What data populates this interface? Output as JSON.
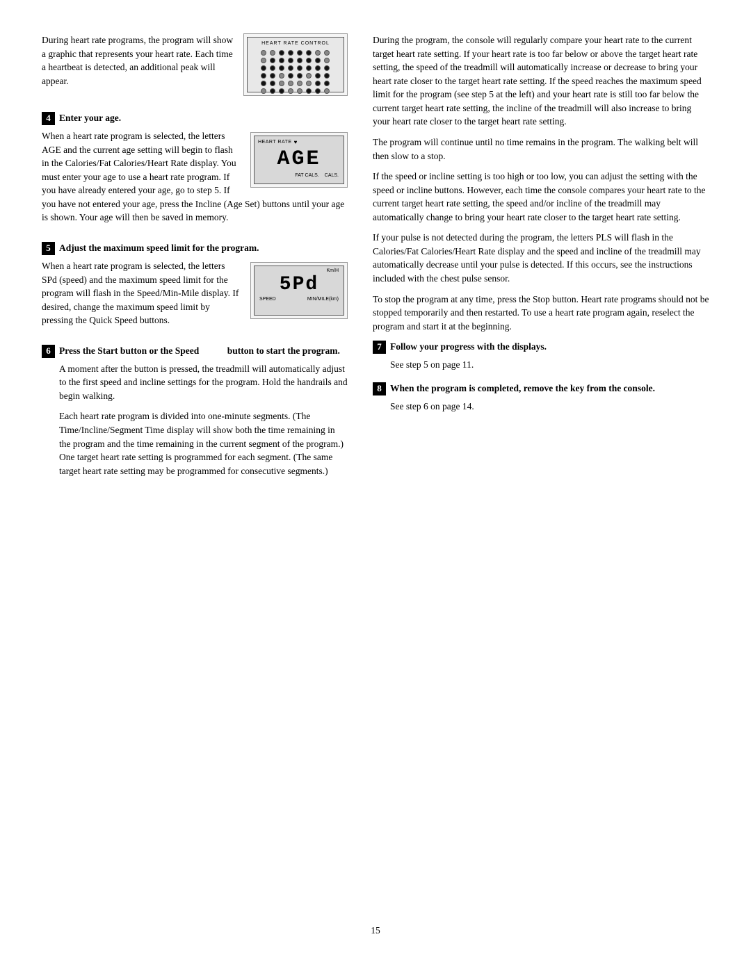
{
  "page": {
    "number": "15"
  },
  "left_col": {
    "intro_para": "During heart rate programs, the program will show a graphic that represents your heart rate. Each time a heartbeat is detected, an additional peak will appear.",
    "step4": {
      "number": "4",
      "title": "Enter your age.",
      "para1": "When a heart rate program is selected, the letters AGE and the current age setting will begin to flash in the Calories/Fat Calories/Heart Rate display. You must enter your age to use a heart rate program. If you have already entered your age, go to step 5. If you have not entered your age, press the Incline (Age Set) buttons until your age is shown. Your age will then be saved in memory."
    },
    "step5": {
      "number": "5",
      "title": "Adjust the maximum speed limit for the program.",
      "para1": "When a heart rate program is selected, the letters SPd (speed) and the maximum speed limit for the program will flash in the Speed/Min-Mile display. If desired, change the maximum speed limit by pressing the Quick Speed buttons."
    },
    "step6": {
      "number": "6",
      "title": "Press the Start button or the Speed",
      "title2": "button to start the program.",
      "para1": "A moment after the button is pressed, the treadmill will automatically adjust to the first speed and incline settings for the program. Hold the handrails and begin walking.",
      "para2": "Each heart rate program is divided into one-minute segments. (The Time/Incline/Segment Time display will show both the time remaining in the program and the time remaining in the current segment of the program.) One target heart rate setting is programmed for each segment. (The same target heart rate setting may be programmed for consecutive segments.)"
    }
  },
  "right_col": {
    "para1": "During the program, the console will regularly compare your heart rate to the current target heart rate setting. If your heart rate is too far below or above the target heart rate setting, the speed of the treadmill will automatically increase or decrease to bring your heart rate closer to the target heart rate setting. If the speed reaches the maximum speed limit for the program (see step 5 at the left) and your heart rate is still too far below the current target heart rate setting, the incline of the treadmill will also increase to bring your heart rate closer to the target heart rate setting.",
    "para2": "The program will continue until no time remains in the program. The walking belt will then slow to a stop.",
    "para3": "If the speed or incline setting is too high or too low, you can adjust the setting with the speed or incline buttons. However, each time the console compares your heart rate to the current target heart rate setting, the speed and/or incline of the treadmill may automatically change to bring your heart rate closer to the target heart rate setting.",
    "para4": "If your pulse is not detected during the program, the letters PLS will flash in the Calories/Fat Calories/Heart Rate display and the speed and incline of the treadmill may automatically decrease until your pulse is detected. If this occurs, see the instructions included with the chest pulse sensor.",
    "para5": "To stop the program at any time, press the Stop button. Heart rate programs should not be stopped temporarily and then restarted. To use a heart rate program again, reselect the program and start it at the beginning.",
    "step7": {
      "number": "7",
      "title": "Follow your progress with the displays.",
      "para1": "See step 5 on page 11."
    },
    "step8": {
      "number": "8",
      "title": "When the program is completed, remove the key from the console.",
      "para1": "See step 6 on page 14."
    }
  },
  "panels": {
    "heartrate_control": {
      "label": "HEART RATE CONTROL",
      "dots": [
        0,
        0,
        1,
        1,
        1,
        1,
        0,
        0,
        0,
        1,
        1,
        1,
        1,
        1,
        1,
        0,
        1,
        1,
        1,
        1,
        1,
        1,
        1,
        1,
        1,
        1,
        0,
        1,
        1,
        0,
        1,
        1,
        1,
        1,
        0,
        0,
        0,
        0,
        1,
        1,
        0,
        1,
        1,
        0,
        0,
        1,
        1,
        0
      ]
    },
    "age_display": {
      "hr_label": "HEART RATE",
      "digits": "AGE",
      "bottom_labels": [
        "FAT CALS.",
        "CALS."
      ]
    },
    "speed_display": {
      "unit_label": "Km/H",
      "digits": "5Pd",
      "bottom_labels": [
        "SPEED",
        "MIN/MILE(km)"
      ]
    }
  }
}
